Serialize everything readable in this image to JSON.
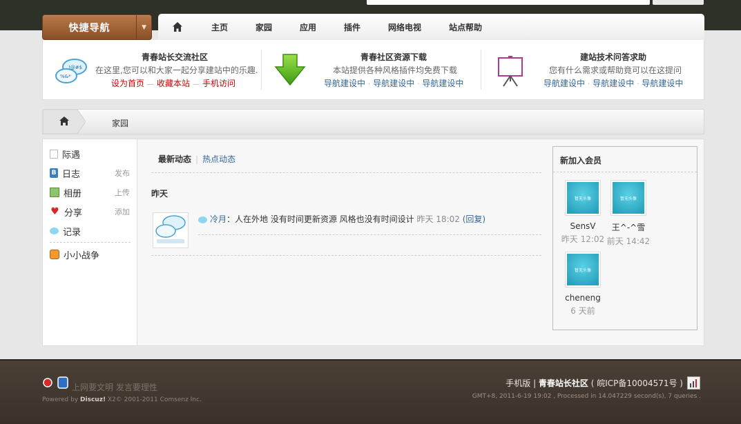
{
  "quick_nav": {
    "label": "快捷导航"
  },
  "nav": {
    "items": [
      "主页",
      "家园",
      "应用",
      "插件",
      "网络电视",
      "站点帮助"
    ]
  },
  "info": [
    {
      "title": "青春站长交流社区",
      "desc": "在这里,您可以和大家一起分享建站中的乐趣.",
      "links": [
        "设为首页",
        "收藏本站",
        "手机访问"
      ]
    },
    {
      "title": "青春社区资源下载",
      "desc": "本站提供各种风格插件均免费下载",
      "links": [
        "导航建设中",
        "导航建设中",
        "导航建设中"
      ]
    },
    {
      "title": "建站技术问答求助",
      "desc": "您有什么需求或帮助竟可以在这提问",
      "links": [
        "导航建设中",
        "导航建设中",
        "导航建设中"
      ]
    }
  ],
  "breadcrumb": {
    "current": "家园"
  },
  "sidebar": {
    "items": [
      {
        "label": "际遇",
        "action": ""
      },
      {
        "label": "日志",
        "action": "发布"
      },
      {
        "label": "相册",
        "action": "上传"
      },
      {
        "label": "分享",
        "action": "添加"
      },
      {
        "label": "记录",
        "action": ""
      },
      {
        "label": "小小战争",
        "action": ""
      }
    ]
  },
  "feed": {
    "tabs": [
      "最新动态",
      "热点动态"
    ],
    "day_label": "昨天",
    "entry": {
      "user": "冷月",
      "text": "：人在外地 没有时间更新资源 风格也没有时间设计",
      "time": "昨天 18:02",
      "reply": "(回复)"
    }
  },
  "members": {
    "title": "新加入会员",
    "avatar_text": "暂无头像",
    "list": [
      {
        "name": "SensV",
        "time": "昨天 12:02"
      },
      {
        "name": "王^-^雪",
        "time": "前天 14:42"
      },
      {
        "name": "cheneng",
        "time": "6 天前"
      }
    ]
  },
  "footer": {
    "slogan": "上网要文明 发言要理性",
    "powered_prefix": "Powered by",
    "powered_brand": "Discuz!",
    "powered_rest": " X2© 2001-2011 Comsenz Inc.",
    "mobile": "手机版",
    "site": "青春站长社区",
    "icp": "( 皖ICP备10004571号 )",
    "stats": "GMT+8, 2011-6-19 19:02 , Processed in 14.047229 second(s), 7 queries ."
  },
  "colors": {
    "link": "#336699",
    "red_link": "#cc0000",
    "nav_orange": "#8a4f27",
    "footer_bg": "#3a3129"
  }
}
